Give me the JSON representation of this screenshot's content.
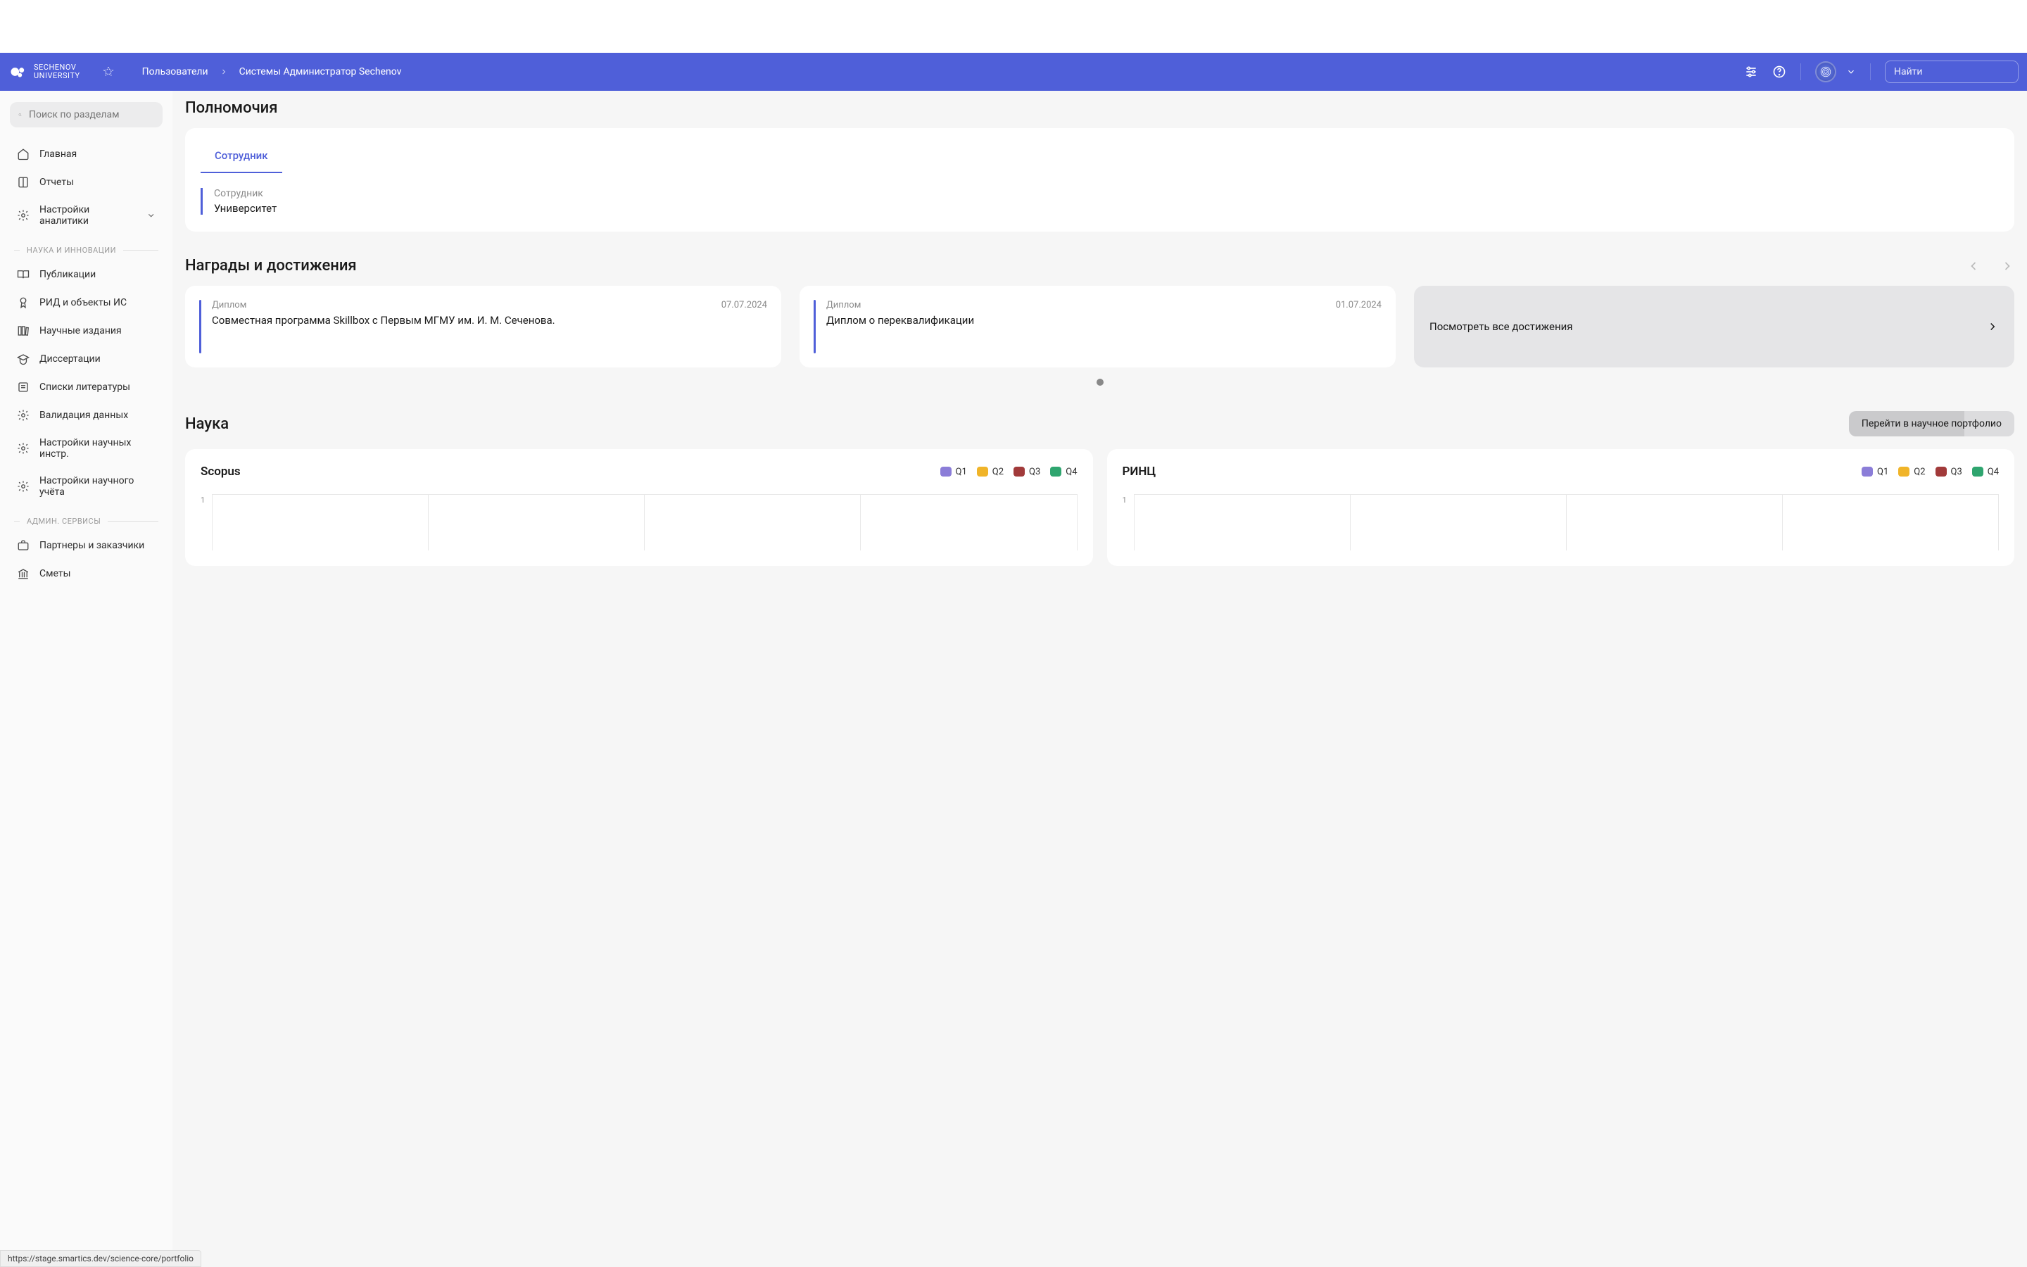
{
  "header": {
    "logo": {
      "line1": "SECHENOV",
      "line2": "UNIVERSITY"
    },
    "breadcrumb": {
      "item1": "Пользователи",
      "item2": "Системы Администратор Sechenov"
    },
    "search_placeholder": "Найти"
  },
  "sidebar": {
    "search_placeholder": "Поиск по разделам",
    "items": {
      "home": "Главная",
      "reports": "Отчеты",
      "analytics_settings": "Настройки аналитики"
    },
    "section_science": "НАУКА И ИННОВАЦИИ",
    "science_items": {
      "publications": "Публикации",
      "ip": "РИД и объекты ИС",
      "journals": "Научные издания",
      "dissertations": "Диссертации",
      "bibliography": "Списки литературы",
      "validation": "Валидация данных",
      "instr_settings": "Настройки научных инстр.",
      "accounting": "Настройки научного учёта"
    },
    "section_admin": "АДМИН. СЕРВИСЫ",
    "admin_items": {
      "partners": "Партнеры и заказчики",
      "estimates": "Сметы"
    }
  },
  "permissions": {
    "title": "Полномочия",
    "tab": "Сотрудник",
    "block_label": "Сотрудник",
    "block_value": "Университет"
  },
  "awards": {
    "title": "Награды и достижения",
    "cards": [
      {
        "type": "Диплом",
        "date": "07.07.2024",
        "title": "Совместная программа Skillbox с Первым МГМУ им. И. М. Сеченова."
      },
      {
        "type": "Диплом",
        "date": "01.07.2024",
        "title": "Диплом о переквалификации"
      }
    ],
    "view_all": "Посмотреть все достижения"
  },
  "science": {
    "title": "Наука",
    "portfolio_btn": "Перейти в научное портфолио"
  },
  "legend": {
    "q1": "Q1",
    "q2": "Q2",
    "q3": "Q3",
    "q4": "Q4"
  },
  "colors": {
    "q1": "#8b7dd8",
    "q2": "#f0b429",
    "q3": "#a13a3a",
    "q4": "#2fa56f"
  },
  "chart_data": [
    {
      "type": "bar",
      "title": "Scopus",
      "categories": [
        "Q1",
        "Q2",
        "Q3",
        "Q4"
      ],
      "values": [
        0,
        0,
        0,
        0
      ],
      "ylim": [
        0,
        1
      ],
      "y_ticks": [
        "1"
      ]
    },
    {
      "type": "bar",
      "title": "РИНЦ",
      "categories": [
        "Q1",
        "Q2",
        "Q3",
        "Q4"
      ],
      "values": [
        0,
        0,
        0,
        0
      ],
      "ylim": [
        0,
        1
      ],
      "y_ticks": [
        "1"
      ]
    }
  ],
  "status_url": "https://stage.smartics.dev/science-core/portfolio"
}
